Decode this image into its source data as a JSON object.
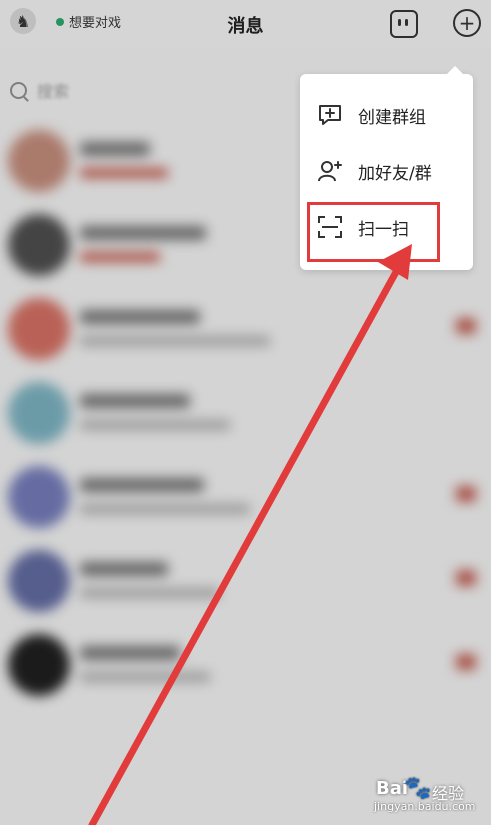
{
  "header": {
    "status_text": "想要对戏",
    "title": "消息",
    "status_color": "#2aa06a"
  },
  "search": {
    "placeholder": "搜索"
  },
  "menu": {
    "items": [
      {
        "label": "创建群组",
        "icon": "chat-plus-icon"
      },
      {
        "label": "加好友/群",
        "icon": "add-user-icon"
      },
      {
        "label": "扫一扫",
        "icon": "scan-icon"
      }
    ]
  },
  "annotation": {
    "highlight_color": "#e23b3b",
    "highlighted_item": "扫一扫"
  },
  "watermark": {
    "brand": "Bai",
    "brand_suffix": "经验",
    "url": "jingyan.baidu.com"
  }
}
